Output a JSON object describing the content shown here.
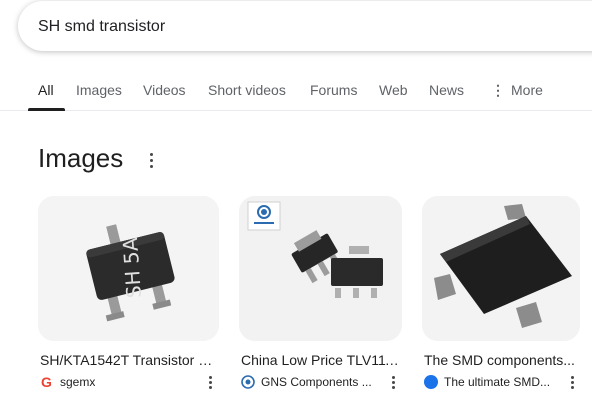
{
  "search": {
    "value": "SH smd transistor"
  },
  "tabs": [
    {
      "label": "All",
      "active": true
    },
    {
      "label": "Images"
    },
    {
      "label": "Videos"
    },
    {
      "label": "Short videos"
    },
    {
      "label": "Forums"
    },
    {
      "label": "Web"
    },
    {
      "label": "News"
    },
    {
      "label": "More",
      "icon": "more-vert-icon"
    }
  ],
  "images_section": {
    "title": "Images",
    "results": [
      {
        "caption": "SH/KTA1542T Transistor P...",
        "source": "sgemx",
        "favicon": "g-logo-icon",
        "chip_marking": "SH 5A"
      },
      {
        "caption": "China Low Price TLV111...",
        "source": "GNS Components ...",
        "favicon": "gns-logo-icon"
      },
      {
        "caption": "The SMD components...",
        "source": "The ultimate SMD...",
        "favicon": "blue-dot-icon"
      }
    ]
  },
  "colors": {
    "accent_red": "#ea4335",
    "accent_blue": "#1a73e8",
    "text": "#1f1f1f",
    "muted": "#5f6368"
  }
}
